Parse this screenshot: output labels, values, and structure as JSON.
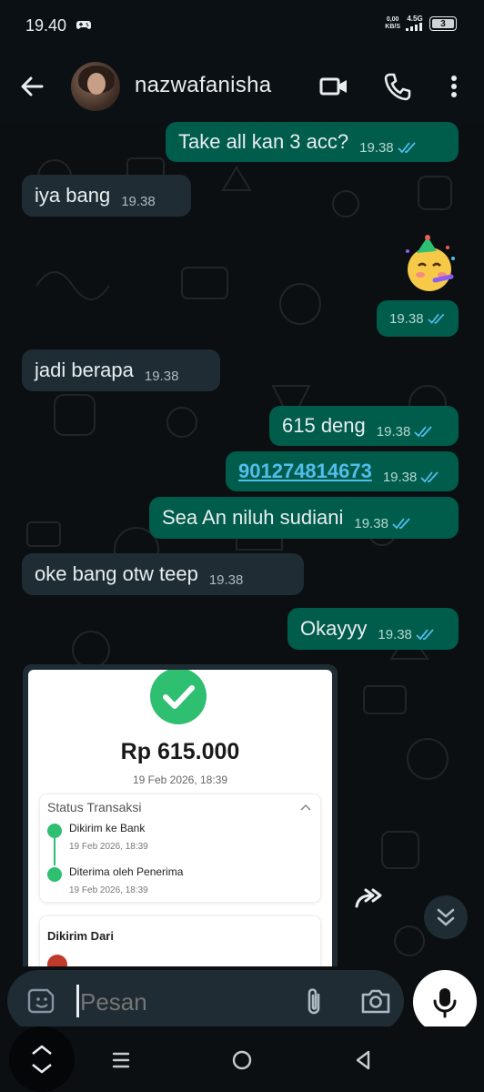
{
  "status_bar": {
    "time": "19.40",
    "net_speed_value": "0,00",
    "net_speed_unit": "KB/S",
    "network": "4.5G",
    "battery": "3"
  },
  "header": {
    "contact_name": "nazwafanisha"
  },
  "messages": [
    {
      "dir": "out",
      "text": "Take all kan 3 acc?",
      "time": "19.38"
    },
    {
      "dir": "in",
      "text": "iya bang",
      "time": "19.38"
    },
    {
      "dir": "out",
      "text": "",
      "time": "19.38",
      "emoji": "partying-face"
    },
    {
      "dir": "in",
      "text": "jadi berapa",
      "time": "19.38"
    },
    {
      "dir": "out",
      "text": "615 deng",
      "time": "19.38"
    },
    {
      "dir": "out",
      "text": "901274814673",
      "time": "19.38",
      "is_link": true
    },
    {
      "dir": "out",
      "text": "Sea An niluh sudiani",
      "time": "19.38"
    },
    {
      "dir": "in",
      "text": "oke bang otw teep",
      "time": "19.38"
    },
    {
      "dir": "out",
      "text": "Okayyy",
      "time": "19.38"
    }
  ],
  "receipt": {
    "amount": "Rp 615.000",
    "date": "19 Feb 2026, 18:39",
    "status_title": "Status Transaksi",
    "steps": [
      {
        "label": "Dikirim ke Bank",
        "date": "19 Feb 2026, 18:39"
      },
      {
        "label": "Diterima oleh Penerima",
        "date": "19 Feb 2026, 18:39"
      }
    ],
    "sender_title": "Dikirim Dari"
  },
  "composer": {
    "placeholder": "Pesan"
  },
  "colors": {
    "outgoing_bubble": "#005c4b",
    "incoming_bubble": "#1f2c34",
    "background": "#0b0f12",
    "read_ticks": "#53bdeb",
    "success_green": "#2fbf71"
  }
}
